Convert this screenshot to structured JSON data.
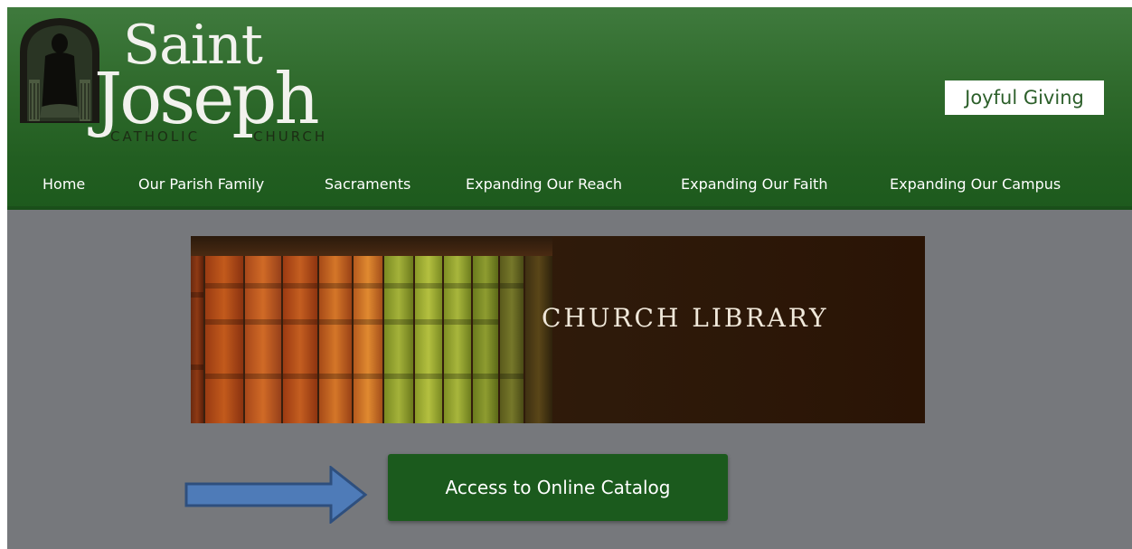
{
  "header": {
    "logo": {
      "line1": "Saint",
      "line2": "Joseph",
      "line3_left": "CATHOLIC",
      "line3_right": "CHURCH"
    },
    "joyful_giving_label": "Joyful Giving"
  },
  "nav": {
    "items": [
      {
        "label": "Home"
      },
      {
        "label": "Our Parish Family"
      },
      {
        "label": "Sacraments"
      },
      {
        "label": "Expanding Our Reach"
      },
      {
        "label": "Expanding Our Faith"
      },
      {
        "label": "Expanding Our Campus"
      }
    ]
  },
  "banner": {
    "title": "CHURCH LIBRARY"
  },
  "catalog_button": {
    "label": "Access to Online Catalog"
  },
  "colors": {
    "header_green": "#2f6a2c",
    "button_green": "#1b5a1d",
    "page_gray": "#76787c",
    "arrow_blue": "#4e7bb8"
  }
}
